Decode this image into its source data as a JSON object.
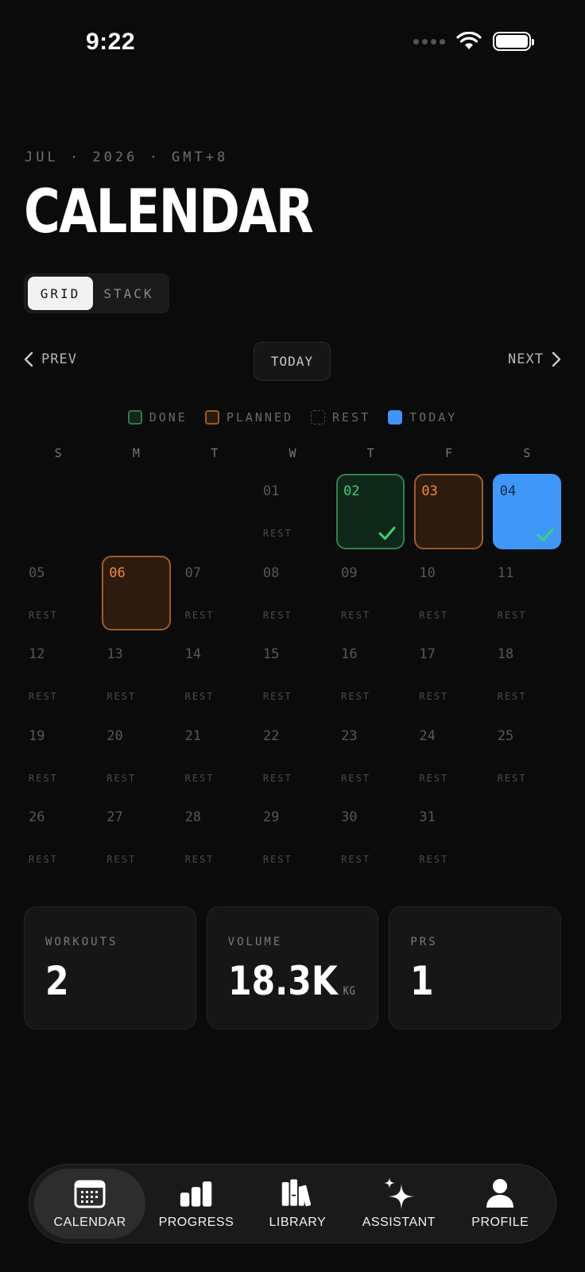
{
  "status": {
    "time": "9:22"
  },
  "header": {
    "eyebrow": "JUL · 2026 · GMT+8",
    "title": "CALENDAR"
  },
  "view_toggle": {
    "grid": "GRID",
    "stack": "STACK"
  },
  "nav": {
    "prev": "PREV",
    "today": "TODAY",
    "next": "NEXT"
  },
  "legend": {
    "done": "DONE",
    "planned": "PLANNED",
    "rest": "REST",
    "today": "TODAY"
  },
  "weekdays": [
    "S",
    "M",
    "T",
    "W",
    "T",
    "F",
    "S"
  ],
  "rest_label": "REST",
  "days": [
    {
      "num": "01",
      "state": "rest"
    },
    {
      "num": "02",
      "state": "done"
    },
    {
      "num": "03",
      "state": "planned"
    },
    {
      "num": "04",
      "state": "today"
    },
    {
      "num": "05",
      "state": "rest"
    },
    {
      "num": "06",
      "state": "planned"
    },
    {
      "num": "07",
      "state": "rest"
    },
    {
      "num": "08",
      "state": "rest"
    },
    {
      "num": "09",
      "state": "rest"
    },
    {
      "num": "10",
      "state": "rest"
    },
    {
      "num": "11",
      "state": "rest"
    },
    {
      "num": "12",
      "state": "rest"
    },
    {
      "num": "13",
      "state": "rest"
    },
    {
      "num": "14",
      "state": "rest"
    },
    {
      "num": "15",
      "state": "rest"
    },
    {
      "num": "16",
      "state": "rest"
    },
    {
      "num": "17",
      "state": "rest"
    },
    {
      "num": "18",
      "state": "rest"
    },
    {
      "num": "19",
      "state": "rest"
    },
    {
      "num": "20",
      "state": "rest"
    },
    {
      "num": "21",
      "state": "rest"
    },
    {
      "num": "22",
      "state": "rest"
    },
    {
      "num": "23",
      "state": "rest"
    },
    {
      "num": "24",
      "state": "rest"
    },
    {
      "num": "25",
      "state": "rest"
    },
    {
      "num": "26",
      "state": "rest"
    },
    {
      "num": "27",
      "state": "rest"
    },
    {
      "num": "28",
      "state": "rest"
    },
    {
      "num": "29",
      "state": "rest"
    },
    {
      "num": "30",
      "state": "rest"
    },
    {
      "num": "31",
      "state": "rest"
    }
  ],
  "stats": {
    "workouts": {
      "label": "WORKOUTS",
      "value": "2"
    },
    "volume": {
      "label": "VOLUME",
      "value": "18.3K",
      "unit": "KG"
    },
    "prs": {
      "label": "PRS",
      "value": "1"
    }
  },
  "tabs": {
    "calendar": "CALENDAR",
    "progress": "PROGRESS",
    "library": "LIBRARY",
    "assistant": "ASSISTANT",
    "profile": "PROFILE"
  },
  "colors": {
    "background": "#0b0b0b",
    "done": "#3bd27a",
    "planned": "#f28b3d",
    "today": "#3f98f8"
  },
  "icons": {
    "cell_check": "check-icon",
    "calendar_tab": "calendar-icon",
    "progress_tab": "bar-chart-icon",
    "library_tab": "books-icon",
    "assistant_tab": "sparkle-icon",
    "profile_tab": "person-icon"
  }
}
